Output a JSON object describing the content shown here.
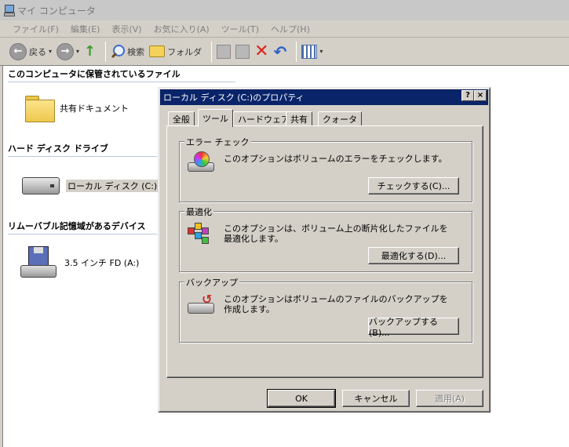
{
  "window": {
    "title": "マイ コンピュータ"
  },
  "menubar": [
    "ファイル(F)",
    "編集(E)",
    "表示(V)",
    "お気に入り(A)",
    "ツール(T)",
    "ヘルプ(H)"
  ],
  "toolbar": {
    "back_label": "戻る",
    "back_glyph": "←",
    "forward_glyph": "→",
    "up_glyph": "↑",
    "search_label": "検索",
    "folders_label": "フォルダ",
    "delete_glyph": "✕",
    "undo_glyph": "↶",
    "dropdown_glyph": "▾"
  },
  "groups": {
    "stored_files": "このコンピュータに保管されているファイル",
    "hard_disks": "ハード ディスク ドライブ",
    "removable": "リムーバブル記憶域があるデバイス"
  },
  "items": {
    "shared_docs": "共有ドキュメント",
    "local_disk": "ローカル ディスク (C:)",
    "floppy": "3.5 インチ FD (A:)"
  },
  "dialog": {
    "title": "ローカル ディスク (C:)のプロパティ",
    "help_glyph": "?",
    "close_glyph": "×",
    "tabs": [
      "全般",
      "ツール",
      "ハードウェア",
      "共有",
      "クォータ"
    ],
    "active_tab": "ツール",
    "error_check": {
      "title": "エラー チェック",
      "desc": "このオプションはボリュームのエラーをチェックします。",
      "button": "チェックする(C)..."
    },
    "defrag": {
      "title": "最適化",
      "desc": "このオプションは、ボリューム上の断片化したファイルを最適化します。",
      "button": "最適化する(D)..."
    },
    "backup": {
      "title": "バックアップ",
      "desc": "このオプションはボリュームのファイルのバックアップを作成します。",
      "button": "バックアップする(B)..."
    },
    "buttons": {
      "ok": "OK",
      "cancel": "キャンセル",
      "apply": "適用(A)"
    }
  },
  "colors": {
    "dialog_title_bg": "#0a246a",
    "face": "#d4d0c8",
    "delete_red": "#d9241c",
    "undo_blue": "#2a62c8"
  }
}
